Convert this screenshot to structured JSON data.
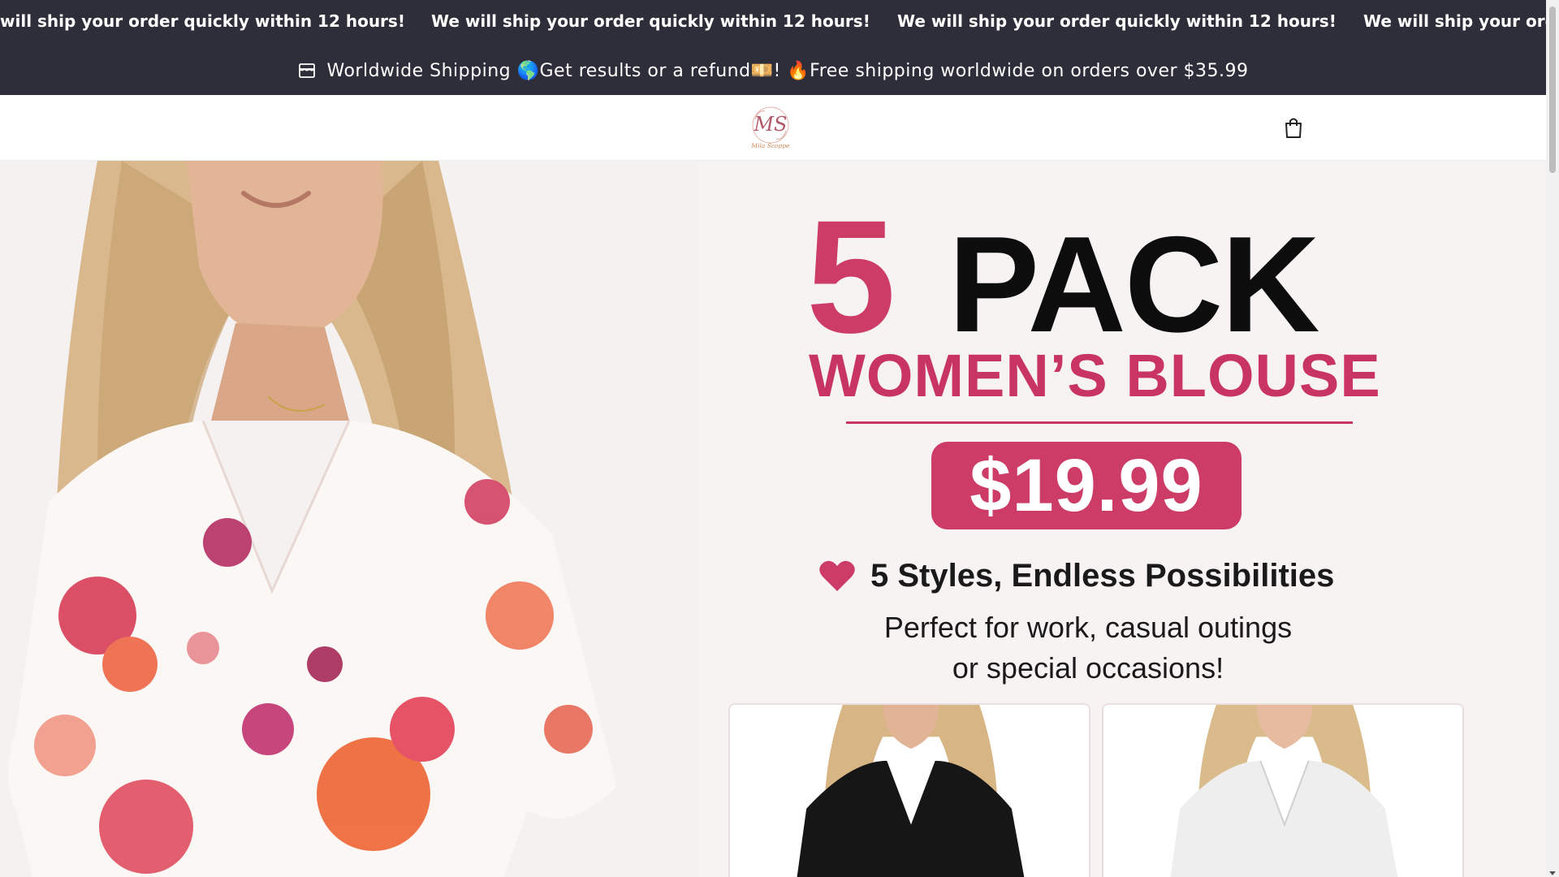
{
  "marquee": {
    "items": [
      "will ship your order quickly within 12 hours!",
      "We will ship your order quickly within 12 hours!",
      "We will ship your order quickly within 12 hours!",
      "We will ship your order"
    ]
  },
  "announcement": {
    "text": "Worldwide Shipping 🌎Get results or a refund💴! 🔥Free shipping worldwide on orders over $35.99",
    "icon": "store-icon"
  },
  "header": {
    "logo_initials": "MS",
    "logo_wordmark": "Mila Scoppe",
    "cart_icon": "shopping-bag-icon"
  },
  "hero": {
    "number": "5",
    "pack": "PACK",
    "subtitle": "WOMEN’S BLOUSE",
    "price": "$19.99",
    "styles_text": "5 Styles, Endless Possibilities",
    "perfect_line1": "Perfect for work, casual outings",
    "perfect_line2": "or special occasions!"
  },
  "colors": {
    "bar_bg": "#2e2e3a",
    "brand_pink": "#cc3c67"
  }
}
